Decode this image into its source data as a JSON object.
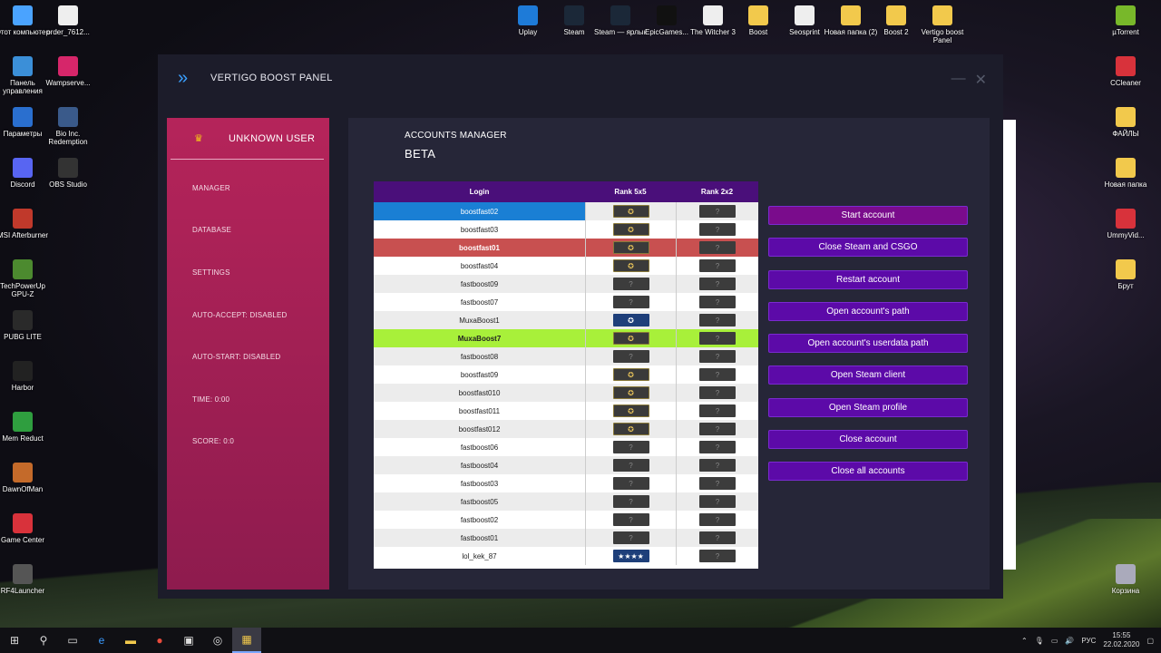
{
  "desktop": {
    "left_icons": [
      {
        "label": "Этот компьютер",
        "icon": "computer-icon",
        "color": "#4aa3ff"
      },
      {
        "label": "Панель управления",
        "icon": "control-panel-icon",
        "color": "#3b8fd8"
      },
      {
        "label": "Параметры",
        "icon": "settings-icon",
        "color": "#2a6fcf"
      },
      {
        "label": "Discord",
        "icon": "discord-icon",
        "color": "#5865f2"
      },
      {
        "label": "MSI Afterburner",
        "icon": "afterburner-icon",
        "color": "#c0392b"
      },
      {
        "label": "TechPowerUp GPU-Z",
        "icon": "gpuz-icon",
        "color": "#4c8a2f"
      },
      {
        "label": "PUBG LITE",
        "icon": "pubg-icon",
        "color": "#2a2a2a"
      },
      {
        "label": "Harbor",
        "icon": "anchor-icon",
        "color": "#222"
      },
      {
        "label": "Mem Reduct",
        "icon": "memreduct-icon",
        "color": "#2f9e3f"
      },
      {
        "label": "DawnOfMan",
        "icon": "dawnofman-icon",
        "color": "#c46a2a"
      },
      {
        "label": "Game Center",
        "icon": "gamecenter-icon",
        "color": "#d8323b"
      },
      {
        "label": "RF4Launcher",
        "icon": "rf4-icon",
        "color": "#555"
      }
    ],
    "col2_icons": [
      {
        "label": "order_7612...",
        "icon": "document-icon",
        "color": "#eee"
      },
      {
        "label": "Wampserve...",
        "icon": "wamp-icon",
        "color": "#d6266a"
      },
      {
        "label": "Bio Inc. Redemption",
        "icon": "bioinc-icon",
        "color": "#3a5a8a"
      },
      {
        "label": "OBS Studio",
        "icon": "obs-icon",
        "color": "#333"
      }
    ],
    "top_icons": [
      {
        "label": "Uplay",
        "icon": "uplay-icon",
        "color": "#1e7bd8"
      },
      {
        "label": "Steam",
        "icon": "steam-icon",
        "color": "#1b2838"
      },
      {
        "label": "Steam — ярлык",
        "icon": "steam-icon",
        "color": "#1b2838"
      },
      {
        "label": "EpicGames...",
        "icon": "epic-icon",
        "color": "#111"
      },
      {
        "label": "The Witcher 3",
        "icon": "document-icon",
        "color": "#eee"
      },
      {
        "label": "Boost",
        "icon": "folder-icon",
        "color": "#f2c94c"
      },
      {
        "label": "Seosprint",
        "icon": "document-icon",
        "color": "#eee"
      },
      {
        "label": "Новая папка (2)",
        "icon": "folder-icon",
        "color": "#f2c94c"
      },
      {
        "label": "Boost 2",
        "icon": "folder-icon",
        "color": "#f2c94c"
      },
      {
        "label": "Vertigo boost Panel",
        "icon": "folder-icon",
        "color": "#f2c94c"
      }
    ],
    "right_icons": [
      {
        "label": "µTorrent",
        "icon": "utorrent-icon",
        "color": "#78b82a"
      },
      {
        "label": "CCleaner",
        "icon": "ccleaner-icon",
        "color": "#d8323b"
      },
      {
        "label": "ФАЙЛЫ",
        "icon": "folder-icon",
        "color": "#f2c94c"
      },
      {
        "label": "Новая папка",
        "icon": "folder-icon",
        "color": "#f2c94c"
      },
      {
        "label": "UmmyVid...",
        "icon": "ummy-icon",
        "color": "#d8323b"
      },
      {
        "label": "Брут",
        "icon": "folder-icon",
        "color": "#f2c94c"
      },
      {
        "label": "Корзина",
        "icon": "recycle-bin-icon",
        "color": "#aab"
      }
    ]
  },
  "app": {
    "title": "VERTIGO BOOST PANEL",
    "user": "UNKNOWN USER",
    "menu": [
      "MANAGER",
      "DATABASE",
      "SETTINGS",
      "AUTO-ACCEPT: DISABLED",
      "AUTO-START: DISABLED",
      "TIME: 0:00",
      "SCORE: 0:0"
    ],
    "section_title": "ACCOUNTS MANAGER",
    "section_sub": "BETA",
    "table": {
      "headers": [
        "Login",
        "Rank 5x5",
        "Rank 2x2"
      ],
      "rows": [
        {
          "login": "boostfast02",
          "r5": "gold",
          "r2": "none",
          "state": "selected"
        },
        {
          "login": "boostfast03",
          "r5": "gold",
          "r2": "none",
          "state": ""
        },
        {
          "login": "boostfast01",
          "r5": "gold",
          "r2": "none",
          "state": "red"
        },
        {
          "login": "boostfast04",
          "r5": "gold",
          "r2": "none",
          "state": ""
        },
        {
          "login": "fastboost09",
          "r5": "none",
          "r2": "none",
          "state": ""
        },
        {
          "login": "fastboost07",
          "r5": "none",
          "r2": "none",
          "state": ""
        },
        {
          "login": "MuxaBoost1",
          "r5": "blue",
          "r2": "none",
          "state": ""
        },
        {
          "login": "MuxaBoost7",
          "r5": "gold",
          "r2": "none",
          "state": "green"
        },
        {
          "login": "fastboost08",
          "r5": "none",
          "r2": "none",
          "state": ""
        },
        {
          "login": "boostfast09",
          "r5": "gold",
          "r2": "none",
          "state": ""
        },
        {
          "login": "boostfast010",
          "r5": "gold",
          "r2": "none",
          "state": ""
        },
        {
          "login": "boostfast011",
          "r5": "gold",
          "r2": "none",
          "state": ""
        },
        {
          "login": "boostfast012",
          "r5": "gold",
          "r2": "none",
          "state": ""
        },
        {
          "login": "fastboost06",
          "r5": "none",
          "r2": "none",
          "state": ""
        },
        {
          "login": "fastboost04",
          "r5": "none",
          "r2": "none",
          "state": ""
        },
        {
          "login": "fastboost03",
          "r5": "none",
          "r2": "none",
          "state": ""
        },
        {
          "login": "fastboost05",
          "r5": "none",
          "r2": "none",
          "state": ""
        },
        {
          "login": "fastboost02",
          "r5": "none",
          "r2": "none",
          "state": ""
        },
        {
          "login": "fastboost01",
          "r5": "none",
          "r2": "none",
          "state": ""
        },
        {
          "login": "lol_kek_87",
          "r5": "stars",
          "r2": "none",
          "state": ""
        }
      ]
    },
    "buttons": [
      "Start account",
      "Close Steam and CSGO",
      "Restart account",
      "Open account's path",
      "Open account's userdata path",
      "Open Steam client",
      "Open Steam profile",
      "Close account",
      "Close all accounts"
    ]
  },
  "taskbar": {
    "lang": "РУС",
    "time": "15:55",
    "date": "22.02.2020"
  }
}
